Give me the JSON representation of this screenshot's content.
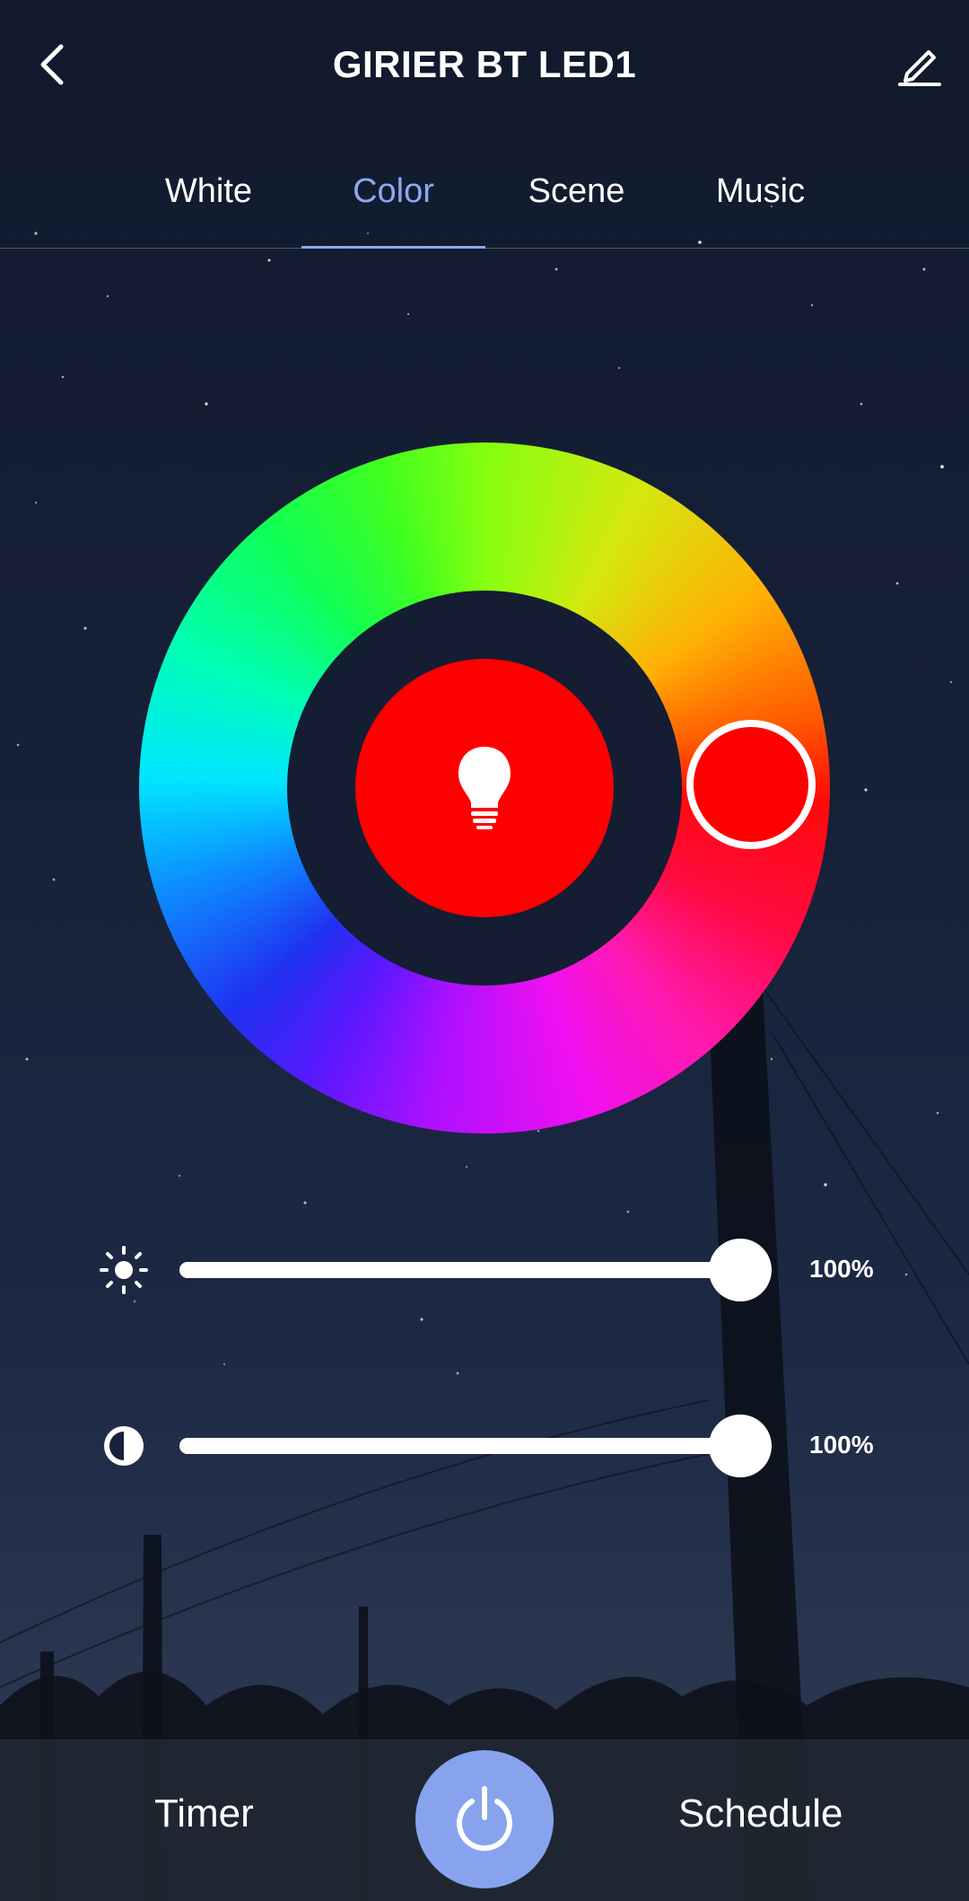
{
  "header": {
    "title": "GIRIER BT LED1",
    "back_icon": "chevron-left-icon",
    "edit_icon": "pencil-icon"
  },
  "tabs": [
    {
      "label": "White",
      "active": false
    },
    {
      "label": "Color",
      "active": true
    },
    {
      "label": "Scene",
      "active": false
    },
    {
      "label": "Music",
      "active": false
    }
  ],
  "color_picker": {
    "selected_color": "#ff0000",
    "center_icon": "lightbulb-icon"
  },
  "sliders": {
    "brightness": {
      "icon": "sun-icon",
      "value": 100,
      "label": "100%"
    },
    "saturation": {
      "icon": "contrast-icon",
      "value": 100,
      "label": "100%"
    }
  },
  "bottom": {
    "timer_label": "Timer",
    "schedule_label": "Schedule",
    "power_icon": "power-icon"
  },
  "colors": {
    "accent": "#8ea7ee",
    "power_button": "#87a3ee",
    "background": "#162038"
  }
}
